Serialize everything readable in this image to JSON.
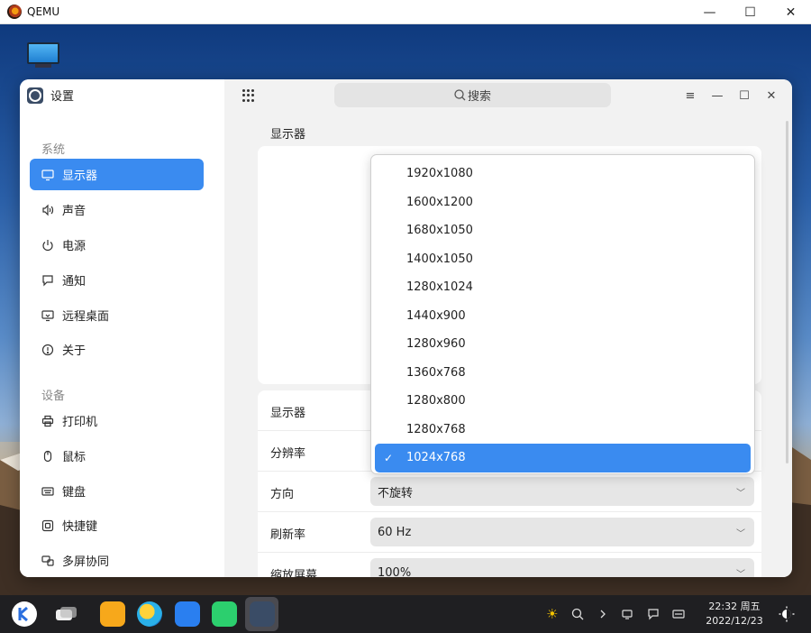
{
  "qemu": {
    "title": "QEMU",
    "minimize": "—",
    "maximize": "☐",
    "close": "✕"
  },
  "settings": {
    "app_title": "设置",
    "search_placeholder": "搜索",
    "window_controls": {
      "menu": "≡",
      "minimize": "—",
      "maximize": "☐",
      "close": "✕"
    }
  },
  "sidebar": {
    "system_label": "系统",
    "device_label": "设备",
    "system_items": [
      {
        "label": "显示器",
        "icon": "monitor-icon",
        "active": true
      },
      {
        "label": "声音",
        "icon": "speaker-icon"
      },
      {
        "label": "电源",
        "icon": "power-icon"
      },
      {
        "label": "通知",
        "icon": "message-icon"
      },
      {
        "label": "远程桌面",
        "icon": "remote-desktop-icon"
      },
      {
        "label": "关于",
        "icon": "info-icon"
      }
    ],
    "device_items": [
      {
        "label": "打印机",
        "icon": "printer-icon"
      },
      {
        "label": "鼠标",
        "icon": "mouse-icon"
      },
      {
        "label": "键盘",
        "icon": "keyboard-icon"
      },
      {
        "label": "快捷键",
        "icon": "shortcut-icon"
      },
      {
        "label": "多屏协同",
        "icon": "multiscreen-icon"
      }
    ]
  },
  "main": {
    "page_title": "显示器",
    "rows": [
      {
        "label": "显示器",
        "value": ""
      },
      {
        "label": "分辨率",
        "value": ""
      },
      {
        "label": "方向",
        "value": "不旋转"
      },
      {
        "label": "刷新率",
        "value": "60 Hz"
      },
      {
        "label": "缩放屏幕",
        "value": "100%"
      }
    ]
  },
  "resolution_dropdown": {
    "options": [
      "1920x1080",
      "1600x1200",
      "1680x1050",
      "1400x1050",
      "1280x1024",
      "1440x900",
      "1280x960",
      "1360x768",
      "1280x800",
      "1280x768",
      "1024x768"
    ],
    "selected": "1024x768",
    "check": "✓"
  },
  "taskbar": {
    "time": "22:32 周五",
    "date": "2022/12/23"
  },
  "colors": {
    "accent": "#3a8bf0",
    "taskbar": "#1f1f22"
  }
}
